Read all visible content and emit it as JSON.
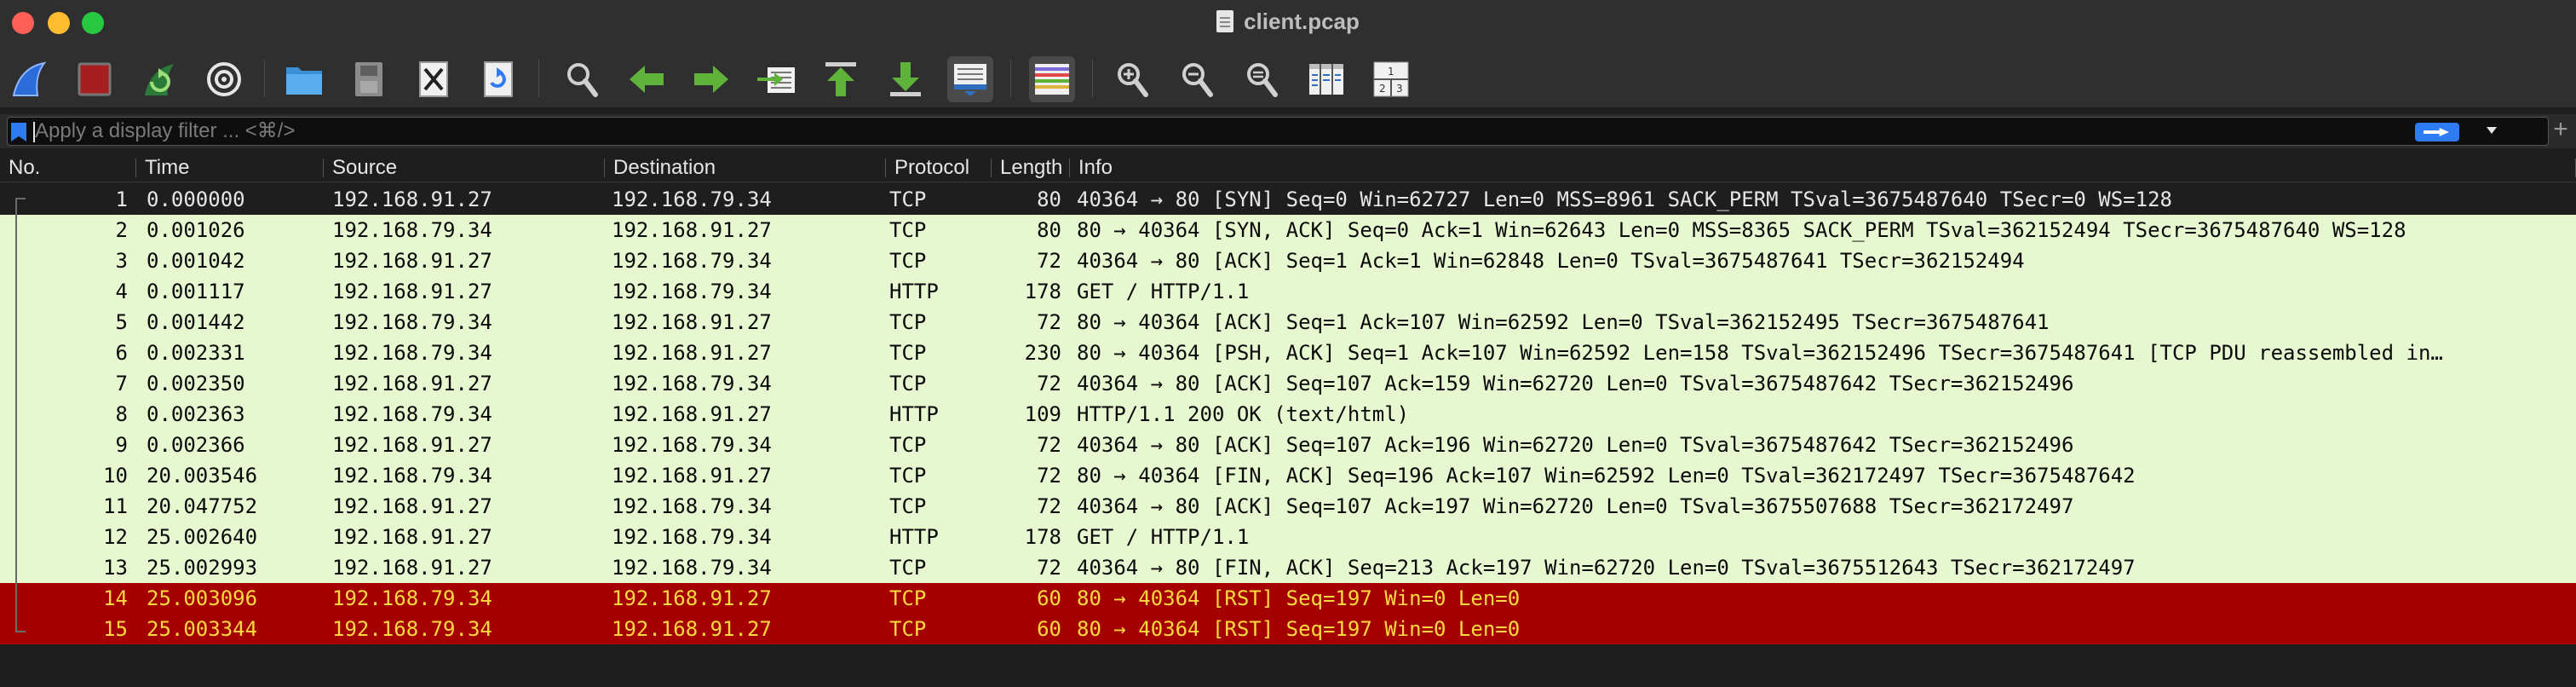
{
  "window": {
    "title": "client.pcap"
  },
  "filter": {
    "placeholder": "Apply a display filter ... <⌘/>",
    "value": ""
  },
  "toolbar": {
    "buttons": [
      "start-capture-icon",
      "stop-capture-icon",
      "restart-capture-icon",
      "capture-options-icon",
      "open-file-icon",
      "save-file-icon",
      "close-file-icon",
      "reload-file-icon",
      "find-packet-icon",
      "go-back-icon",
      "go-forward-icon",
      "go-to-packet-icon",
      "go-first-packet-icon",
      "go-last-packet-icon",
      "auto-scroll-icon",
      "colorize-icon",
      "zoom-in-icon",
      "zoom-out-icon",
      "normal-size-icon",
      "resize-columns-icon",
      "layout-icon"
    ]
  },
  "columns": [
    "No.",
    "Time",
    "Source",
    "Destination",
    "Protocol",
    "Length",
    "Info"
  ],
  "packets": [
    {
      "no": "1",
      "time": "0.000000",
      "src": "192.168.91.27",
      "dst": "192.168.79.34",
      "proto": "TCP",
      "len": "80",
      "info": "40364 → 80 [SYN] Seq=0 Win=62727 Len=0 MSS=8961 SACK_PERM TSval=3675487640 TSecr=0 WS=128",
      "kind": "first"
    },
    {
      "no": "2",
      "time": "0.001026",
      "src": "192.168.79.34",
      "dst": "192.168.91.27",
      "proto": "TCP",
      "len": "80",
      "info": "80 → 40364 [SYN, ACK] Seq=0 Ack=1 Win=62643 Len=0 MSS=8365 SACK_PERM TSval=362152494 TSecr=3675487640 WS=128",
      "kind": "tcp"
    },
    {
      "no": "3",
      "time": "0.001042",
      "src": "192.168.91.27",
      "dst": "192.168.79.34",
      "proto": "TCP",
      "len": "72",
      "info": "40364 → 80 [ACK] Seq=1 Ack=1 Win=62848 Len=0 TSval=3675487641 TSecr=362152494",
      "kind": "tcp"
    },
    {
      "no": "4",
      "time": "0.001117",
      "src": "192.168.91.27",
      "dst": "192.168.79.34",
      "proto": "HTTP",
      "len": "178",
      "info": "GET / HTTP/1.1",
      "kind": "http"
    },
    {
      "no": "5",
      "time": "0.001442",
      "src": "192.168.79.34",
      "dst": "192.168.91.27",
      "proto": "TCP",
      "len": "72",
      "info": "80 → 40364 [ACK] Seq=1 Ack=107 Win=62592 Len=0 TSval=362152495 TSecr=3675487641",
      "kind": "tcp"
    },
    {
      "no": "6",
      "time": "0.002331",
      "src": "192.168.79.34",
      "dst": "192.168.91.27",
      "proto": "TCP",
      "len": "230",
      "info": "80 → 40364 [PSH, ACK] Seq=1 Ack=107 Win=62592 Len=158 TSval=362152496 TSecr=3675487641 [TCP PDU reassembled in…",
      "kind": "tcp"
    },
    {
      "no": "7",
      "time": "0.002350",
      "src": "192.168.91.27",
      "dst": "192.168.79.34",
      "proto": "TCP",
      "len": "72",
      "info": "40364 → 80 [ACK] Seq=107 Ack=159 Win=62720 Len=0 TSval=3675487642 TSecr=362152496",
      "kind": "tcp"
    },
    {
      "no": "8",
      "time": "0.002363",
      "src": "192.168.79.34",
      "dst": "192.168.91.27",
      "proto": "HTTP",
      "len": "109",
      "info": "HTTP/1.1 200 OK  (text/html)",
      "kind": "http"
    },
    {
      "no": "9",
      "time": "0.002366",
      "src": "192.168.91.27",
      "dst": "192.168.79.34",
      "proto": "TCP",
      "len": "72",
      "info": "40364 → 80 [ACK] Seq=107 Ack=196 Win=62720 Len=0 TSval=3675487642 TSecr=362152496",
      "kind": "tcp"
    },
    {
      "no": "10",
      "time": "20.003546",
      "src": "192.168.79.34",
      "dst": "192.168.91.27",
      "proto": "TCP",
      "len": "72",
      "info": "80 → 40364 [FIN, ACK] Seq=196 Ack=107 Win=62592 Len=0 TSval=362172497 TSecr=3675487642",
      "kind": "tcp"
    },
    {
      "no": "11",
      "time": "20.047752",
      "src": "192.168.91.27",
      "dst": "192.168.79.34",
      "proto": "TCP",
      "len": "72",
      "info": "40364 → 80 [ACK] Seq=107 Ack=197 Win=62720 Len=0 TSval=3675507688 TSecr=362172497",
      "kind": "tcp"
    },
    {
      "no": "12",
      "time": "25.002640",
      "src": "192.168.91.27",
      "dst": "192.168.79.34",
      "proto": "HTTP",
      "len": "178",
      "info": "GET / HTTP/1.1",
      "kind": "http"
    },
    {
      "no": "13",
      "time": "25.002993",
      "src": "192.168.91.27",
      "dst": "192.168.79.34",
      "proto": "TCP",
      "len": "72",
      "info": "40364 → 80 [FIN, ACK] Seq=213 Ack=197 Win=62720 Len=0 TSval=3675512643 TSecr=362172497",
      "kind": "tcp"
    },
    {
      "no": "14",
      "time": "25.003096",
      "src": "192.168.79.34",
      "dst": "192.168.91.27",
      "proto": "TCP",
      "len": "60",
      "info": "80 → 40364 [RST] Seq=197 Win=0 Len=0",
      "kind": "rst"
    },
    {
      "no": "15",
      "time": "25.003344",
      "src": "192.168.79.34",
      "dst": "192.168.91.27",
      "proto": "TCP",
      "len": "60",
      "info": "80 → 40364 [RST] Seq=197 Win=0 Len=0",
      "kind": "rst"
    }
  ],
  "colors": {
    "tcp_row": "#e7f7d0",
    "rst_row": "#a40000",
    "rst_text": "#ffd940",
    "accent": "#2f7bf3"
  }
}
